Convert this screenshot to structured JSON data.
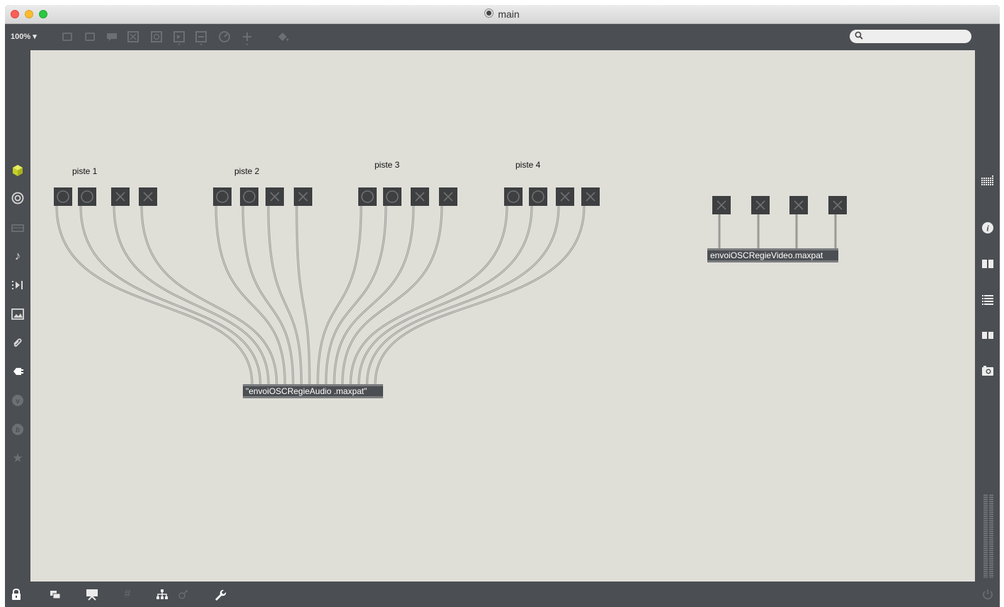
{
  "window": {
    "title": "main"
  },
  "toolbar": {
    "zoom": "100%",
    "zoom_arrow": "▾",
    "search_placeholder": "",
    "icons": [
      "new-object-icon",
      "message-icon",
      "comment-icon",
      "toggle-object-icon",
      "button-object-icon",
      "number-object-icon",
      "slider-object-icon",
      "dial-object-icon",
      "add-icon",
      "paint-bucket-icon"
    ]
  },
  "left_sidebar": {
    "icons": [
      "package-cube-icon",
      "target-icon",
      "cassette-icon",
      "music-note-icon",
      "play-step-icon",
      "image-icon",
      "paperclip-icon",
      "plug-icon",
      "vimeo-icon",
      "beat-icon",
      "star-icon"
    ]
  },
  "right_sidebar": {
    "icons": [
      "grid-icon",
      "info-icon",
      "columns-icon",
      "list-icon",
      "book-icon",
      "camera-icon"
    ]
  },
  "bottom_bar": {
    "icons": [
      "lock-icon",
      "window-stack-icon",
      "presentation-icon",
      "grid-snap-icon",
      "hierarchy-icon",
      "dependency-icon",
      "wrench-icon",
      "power-icon"
    ]
  },
  "patch": {
    "tracks": [
      {
        "label": "piste 1"
      },
      {
        "label": "piste 2"
      },
      {
        "label": "piste 3"
      },
      {
        "label": "piste 4"
      }
    ],
    "audio_object": "\"envoiOSCRegieAudio .maxpat\"",
    "video_object": "envoiOSCRegieVideo.maxpat",
    "audio_controls": [
      "circle",
      "circle",
      "x",
      "x",
      "circle",
      "circle",
      "x",
      "x",
      "circle",
      "circle",
      "x",
      "x",
      "circle",
      "circle",
      "x",
      "x"
    ],
    "video_controls": [
      "x",
      "x",
      "x",
      "x"
    ]
  },
  "colors": {
    "canvas": "#dfdfd8",
    "chrome": "#4b4e52",
    "object_box": "#3d3f41",
    "cable": "#9a9a96",
    "accent_cube": "#d7e33a"
  }
}
